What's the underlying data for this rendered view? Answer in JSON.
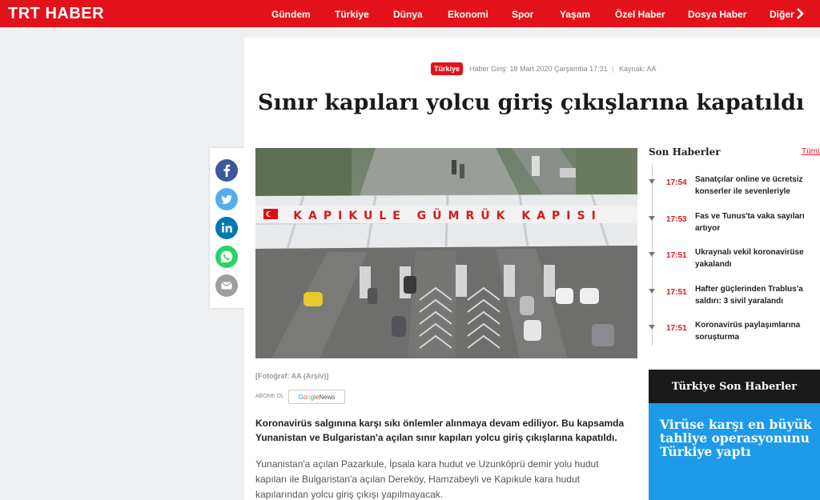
{
  "brand": {
    "logo_trt": "TRT",
    "logo_haber": "HABER"
  },
  "nav": {
    "items": [
      "Gündem",
      "Türkiye",
      "Dünya",
      "Ekonomi",
      "Spor",
      "Yaşam",
      "Özel Haber",
      "Dosya Haber",
      "Diğer"
    ]
  },
  "article": {
    "category": "Türkiye",
    "date_line": "Haber Giriş: 18 Mart 2020 Çarşamba 17:31",
    "source": "Kaynak: AA",
    "title": "Sınır kapıları yolcu giriş çıkışlarına kapatıldı",
    "photo_sign": "KAPIKULE GÜMRÜK KAPISI",
    "caption": "[Fotoğraf: AA (Arşiv)]",
    "subscribe_label": "ABONE OL",
    "google_news": {
      "g": "G",
      "o1": "o",
      "o2": "o",
      "g2": "g",
      "l": "l",
      "e": "e",
      "news": " News"
    },
    "lead": "Koronavirüs salgınına karşı sıkı önlemler alınmaya devam ediliyor. Bu kapsamda Yunanistan ve Bulgaristan'a açılan sınır kapıları yolcu giriş çıkışlarına kapatıldı.",
    "body": "Yunanistan'a açılan Pazarkule, İpsala kara hudut ve Uzunköprü demir yolu hudut kapıları ile Bulgaristan'a açılan Dereköy, Hamzabeyli ve Kapıkule kara hudut kapılarından yolcu giriş çıkışı yapılmayacak."
  },
  "sidebar": {
    "title": "Son Haberler",
    "all_link": "Tümü",
    "items": [
      {
        "time": "17:54",
        "headline": "Sanatçılar online ve ücretsiz konserler ile sevenleriyle"
      },
      {
        "time": "17:53",
        "headline": "Fas ve Tunus'ta vaka sayıları artıyor"
      },
      {
        "time": "17:51",
        "headline": "Ukraynalı vekil koronavirüse yakalandı"
      },
      {
        "time": "17:51",
        "headline": "Hafter güçlerinden Trablus'a saldırı: 3 sivil yaralandı"
      },
      {
        "time": "17:51",
        "headline": "Koronavirüs paylaşımlarına soruşturma"
      }
    ],
    "tr_section_title": "Türkiye Son Haberler",
    "promo_headline": "Virüse karşı en büyük tahliye operasyonunu Türkiye yaptı"
  },
  "share": {
    "icons": [
      "facebook-icon",
      "twitter-icon",
      "linkedin-icon",
      "whatsapp-icon",
      "email-icon"
    ]
  },
  "colors": {
    "brand_red": "#e3121a",
    "promo_blue": "#1e9be8",
    "facebook": "#3b5998",
    "twitter": "#55acee",
    "linkedin": "#0077b5",
    "whatsapp": "#25d366",
    "email": "#9e9e9e"
  }
}
